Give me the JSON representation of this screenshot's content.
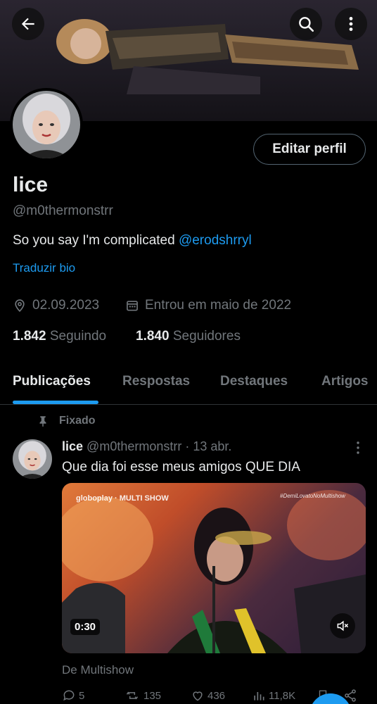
{
  "header": {
    "back_icon": "arrow-left-icon",
    "search_icon": "search-icon",
    "more_icon": "more-vertical-icon"
  },
  "profile": {
    "edit_label": "Editar perfil",
    "name": "lice",
    "handle": "@m0thermonstrr",
    "bio_text": "So you say I'm complicated ",
    "bio_mention": "@erodshrryl",
    "translate_label": "Traduzir bio",
    "birthday": "02.09.2023",
    "joined": "Entrou em maio de 2022",
    "following_count": "1.842",
    "following_label": "Seguindo",
    "followers_count": "1.840",
    "followers_label": "Seguidores"
  },
  "tabs": [
    {
      "label": "Publicações",
      "active": true
    },
    {
      "label": "Respostas",
      "active": false
    },
    {
      "label": "Destaques",
      "active": false
    },
    {
      "label": "Artigos",
      "active": false
    }
  ],
  "tweet": {
    "pinned_label": "Fixado",
    "name": "lice",
    "handle_date": "@m0thermonstrr · 13 abr.",
    "text": "Que dia foi esse meus amigos QUE DIA",
    "media": {
      "logo": "globoplay · MULTI SHOW",
      "tag": "#DemiLovatoNoMultishow",
      "duration": "0:30"
    },
    "source": "De Multishow",
    "replies": "5",
    "retweets": "135",
    "likes": "436",
    "views": "11,8K"
  },
  "colors": {
    "accent": "#1d9bf0",
    "muted": "#71767b",
    "text": "#e7e9ea",
    "border": "#2f3336"
  }
}
